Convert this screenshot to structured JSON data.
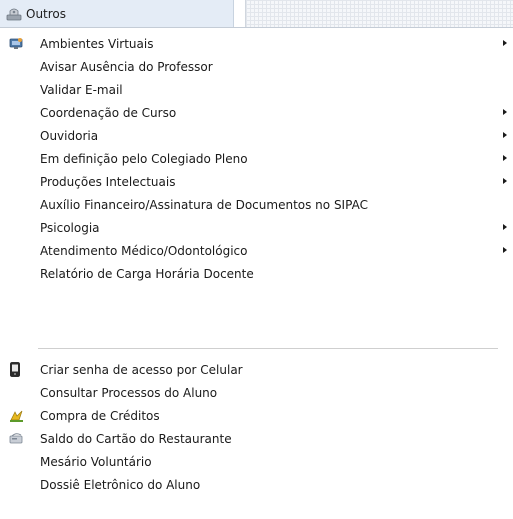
{
  "header": {
    "tab_label": "Outros"
  },
  "menu": {
    "group1": [
      {
        "label": "Ambientes Virtuais",
        "submenu": true,
        "icon": "virtual-environment-icon"
      },
      {
        "label": "Avisar Ausência do Professor",
        "submenu": false
      },
      {
        "label": "Validar E-mail",
        "submenu": false
      },
      {
        "label": "Coordenação de Curso",
        "submenu": true
      },
      {
        "label": "Ouvidoria",
        "submenu": true
      },
      {
        "label": "Em definição pelo Colegiado Pleno",
        "submenu": true
      },
      {
        "label": "Produções Intelectuais",
        "submenu": true
      },
      {
        "label": "Auxílio Financeiro/Assinatura de Documentos no SIPAC",
        "submenu": false
      },
      {
        "label": "Psicologia",
        "submenu": true
      },
      {
        "label": "Atendimento Médico/Odontológico",
        "submenu": true
      },
      {
        "label": "Relatório de Carga Horária Docente",
        "submenu": false
      }
    ],
    "group2": [
      {
        "label": "Criar senha de acesso por Celular",
        "icon": "mobile-phone-icon"
      },
      {
        "label": "Consultar Processos do Aluno"
      },
      {
        "label": "Compra de Créditos",
        "icon": "credit-purchase-icon"
      },
      {
        "label": "Saldo do Cartão do Restaurante",
        "icon": "restaurant-card-icon"
      },
      {
        "label": "Mesário Voluntário"
      },
      {
        "label": "Dossiê Eletrônico do Aluno"
      }
    ]
  },
  "colors": {
    "tab_background": "#e4ecf6",
    "text": "#1a1a1a",
    "separator": "#cfcfcf"
  }
}
